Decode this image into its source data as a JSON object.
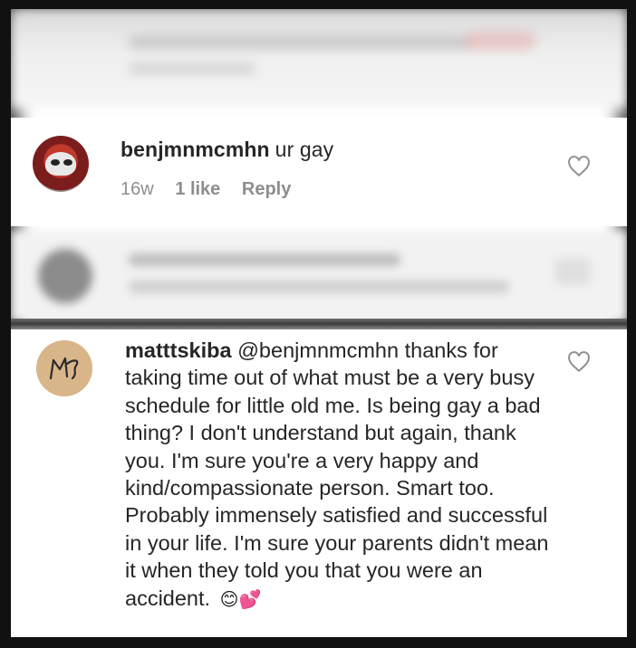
{
  "comments": [
    {
      "username": "benjmnmcmhn",
      "text": "ur gay",
      "time": "16w",
      "likes": "1 like",
      "reply_label": "Reply",
      "like_icon": "heart-outline-icon"
    },
    {
      "username": "matttskiba",
      "mention": "@benjmnmcmhn",
      "text": " thanks for taking time out of what must be a very busy schedule for little old me. Is being gay a bad thing? I don't understand but again, thank you. I'm sure you're a very happy and kind/compassionate person. Smart too. Probably immensely satisfied and successful in your life. I'm sure your parents didn't mean it when they told you that you were an accident.",
      "emojis": "😊💕",
      "avatar_text": "MS",
      "like_icon": "heart-outline-icon"
    }
  ]
}
